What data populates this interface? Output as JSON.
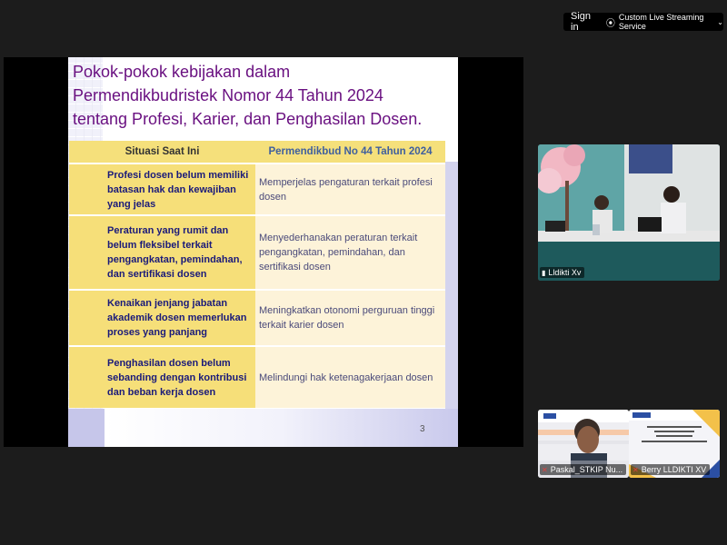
{
  "header": {
    "sign_in": "Sign in",
    "streaming_label": "Custom Live Streaming Service"
  },
  "slide": {
    "title_lines": [
      "Pokok-pokok kebijakan dalam",
      "Permendikbudristek Nomor 44 Tahun 2024",
      "tentang Profesi, Karier, dan Penghasilan Dosen."
    ],
    "columns": [
      "Situasi Saat Ini",
      "Permendikbud No 44 Tahun 2024"
    ],
    "rows": [
      {
        "current": "Profesi dosen belum memiliki batasan hak dan kewajiban yang jelas",
        "policy": "Memperjelas pengaturan terkait profesi dosen"
      },
      {
        "current": "Peraturan yang rumit dan belum fleksibel terkait pengangkatan, pemindahan, dan sertifikasi dosen",
        "policy": "Menyederhanakan peraturan terkait pengangkatan, pemindahan, dan sertifikasi dosen"
      },
      {
        "current": "Kenaikan jenjang jabatan akademik dosen memerlukan proses yang panjang",
        "policy": "Meningkatkan otonomi perguruan tinggi terkait karier dosen"
      },
      {
        "current": "Penghasilan dosen belum sebanding dengan kontribusi dan beban kerja dosen",
        "policy": "Melindungi hak ketenagakerjaan dosen"
      }
    ],
    "page_number": "3"
  },
  "participants": [
    {
      "name": "Lldikti Xv",
      "muted": false
    },
    {
      "name": "Paskal_STKIP Nu...",
      "muted": true
    },
    {
      "name": "Berry LLDIKTI XV",
      "muted": true
    }
  ],
  "colors": {
    "title": "#6a1181",
    "table_header": "#f5e07b",
    "table_left": "#f6df79",
    "table_right": "#fdf3d9"
  }
}
